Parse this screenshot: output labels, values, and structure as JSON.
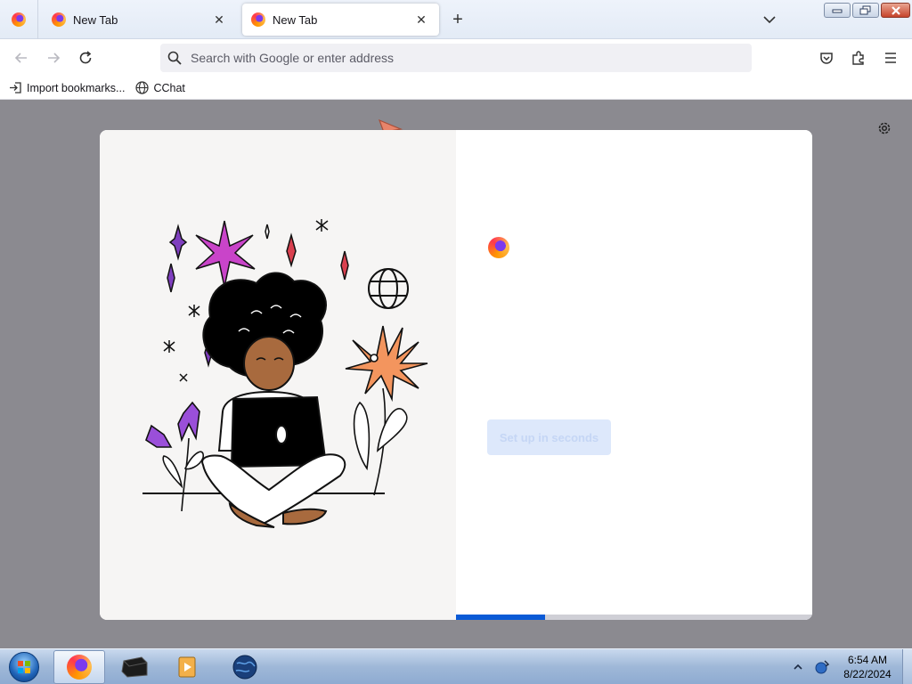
{
  "tabs": [
    {
      "title": "New Tab",
      "close_label": "✕"
    },
    {
      "title": "New Tab",
      "close_label": "✕"
    }
  ],
  "new_tab_label": "+",
  "address_bar": {
    "placeholder": "Search with Google or enter address"
  },
  "bookmarks": [
    {
      "label": "Import bookmarks..."
    },
    {
      "label": "CChat"
    }
  ],
  "onboarding": {
    "button_label": "Set up in seconds",
    "progress": 0.25
  },
  "taskbar": {
    "time": "6:54 AM",
    "date": "8/22/2024"
  },
  "colors": {
    "accent": "#0a5ad6",
    "window_close": "#c5432a",
    "content_backdrop": "#8b8a90"
  }
}
